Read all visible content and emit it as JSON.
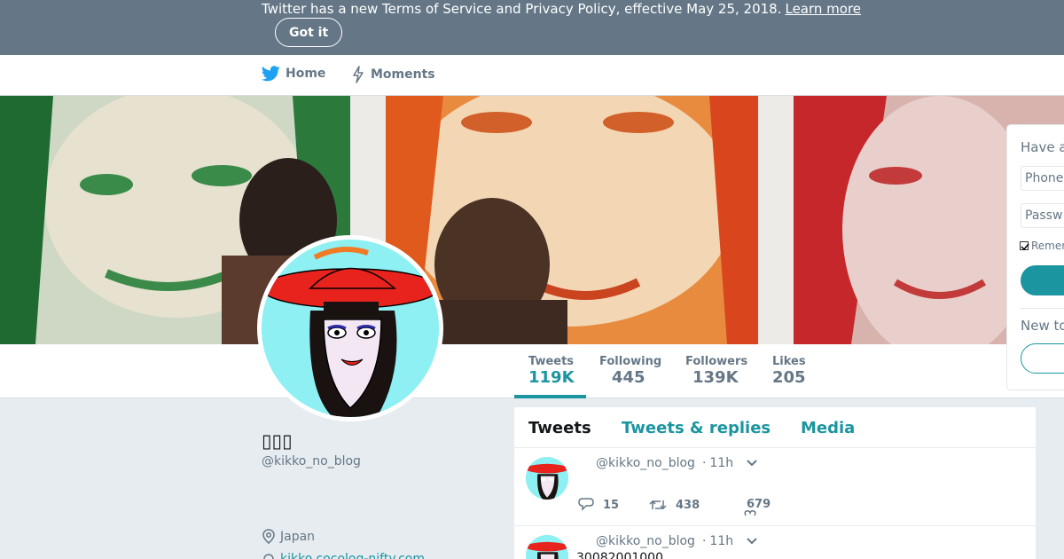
{
  "banner": {
    "text": "Twitter has a new Terms of Service and Privacy Policy, effective May 25, 2018.",
    "link": "Learn more",
    "button": "Got it"
  },
  "nav": {
    "home": "Home",
    "moments": "Moments"
  },
  "stats": [
    {
      "label": "Tweets",
      "value": "119K"
    },
    {
      "label": "Following",
      "value": "445"
    },
    {
      "label": "Followers",
      "value": "139K"
    },
    {
      "label": "Likes",
      "value": "205"
    }
  ],
  "profile": {
    "name": "▯▯▯",
    "handle": "@kikko_no_blog",
    "location": "Japan",
    "url": "kikko.cocolog-nifty.com"
  },
  "timeline": {
    "tabs": [
      "Tweets",
      "Tweets & replies",
      "Media"
    ],
    "tweets": [
      {
        "handle": "@kikko_no_blog",
        "time": "11h",
        "replies": "15",
        "retweets": "438",
        "likes": "679",
        "text": ""
      },
      {
        "handle": "@kikko_no_blog",
        "time": "11h",
        "text": "30082001000"
      }
    ]
  },
  "login": {
    "title": "Have a",
    "phone_placeholder": "Phone",
    "password_placeholder": "Passw",
    "remember": "Remem",
    "new_to": "New to"
  },
  "colors": {
    "accent": "#1b95a0",
    "banner": "#657786",
    "twitter_blue": "#1da1f2"
  }
}
